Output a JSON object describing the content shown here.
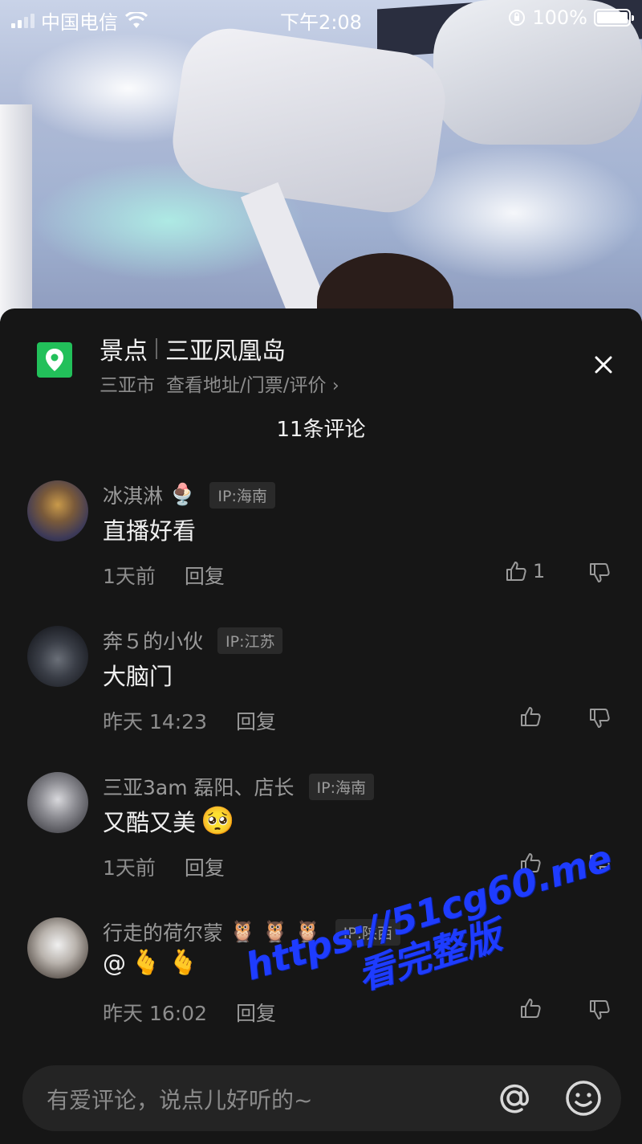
{
  "status_bar": {
    "carrier": "中国电信",
    "time": "下午2:08",
    "battery": "100%"
  },
  "poi": {
    "category": "景点",
    "name": "三亚凤凰岛",
    "city": "三亚市",
    "link": "查看地址/门票/评价",
    "icon": "location-pin-icon",
    "accent": "#22c05a"
  },
  "comments_header": {
    "title": "11条评论"
  },
  "comments": [
    {
      "user": "冰淇淋",
      "user_emoji": "🍨",
      "ip": "IP:海南",
      "text": "直播好看",
      "text_emoji": "",
      "time": "1天前",
      "reply": "回复",
      "likes": "1"
    },
    {
      "user": "奔５的小伙",
      "user_emoji": "",
      "ip": "IP:江苏",
      "text": "大脑门",
      "text_emoji": "",
      "time": "昨天 14:23",
      "reply": "回复",
      "likes": ""
    },
    {
      "user": "三亚3am 磊阳、店长",
      "user_emoji": "",
      "ip": "IP:海南",
      "text": "又酷又美",
      "text_emoji": "🥺",
      "time": "1天前",
      "reply": "回复",
      "likes": ""
    },
    {
      "user": "行走的荷尔蒙",
      "user_emoji": "🦉 🦉 🦉",
      "ip": "IP:陕西",
      "text": "@",
      "text_emoji": "🫰 🫰",
      "time": "昨天 16:02",
      "reply": "回复",
      "likes": ""
    }
  ],
  "watermark": {
    "line1": "https://51cg60.me",
    "line2": "看完整版"
  },
  "input": {
    "placeholder": "有爱评论，说点儿好听的~"
  }
}
